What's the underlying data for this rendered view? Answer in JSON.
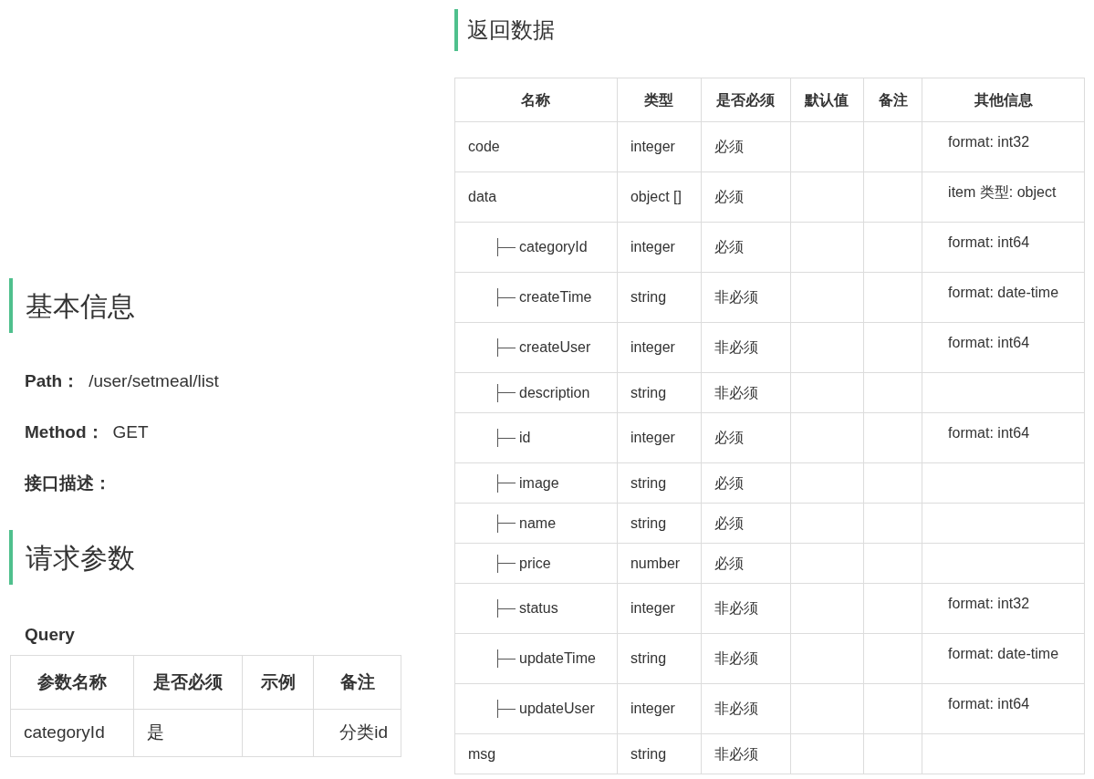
{
  "basic_info": {
    "heading": "基本信息",
    "fields": [
      {
        "label": "Path：",
        "value": "/user/setmeal/list"
      },
      {
        "label": "Method：",
        "value": "GET"
      },
      {
        "label": "接口描述："
      }
    ]
  },
  "request_params": {
    "heading": "请求参数",
    "query_title": "Query",
    "table": {
      "columns": [
        "参数名称",
        "是否必须",
        "示例",
        "备注"
      ],
      "rows": [
        [
          "categoryId",
          "是",
          "",
          "分类id"
        ]
      ]
    }
  },
  "response": {
    "heading": "返回数据",
    "table": {
      "columns": [
        "名称",
        "类型",
        "是否必须",
        "默认值",
        "备注",
        "其他信息"
      ],
      "rows": [
        {
          "name": "code",
          "type": "integer",
          "required": "必须",
          "info": "format: int32"
        },
        {
          "name": "data",
          "type": "object []",
          "required": "必须",
          "info": "item 类型: object",
          "children": [
            {
              "name": "categoryId",
              "type": "integer",
              "required": "必须",
              "info": "format: int64"
            },
            {
              "name": "createTime",
              "type": "string",
              "required": "非必须",
              "info": "format: date-time"
            },
            {
              "name": "createUser",
              "type": "integer",
              "required": "非必须",
              "info": "format: int64"
            },
            {
              "name": "description",
              "type": "string",
              "required": "非必须"
            },
            {
              "name": "id",
              "type": "integer",
              "required": "必须",
              "info": "format: int64"
            },
            {
              "name": "image",
              "type": "string",
              "required": "必须"
            },
            {
              "name": "name",
              "type": "string",
              "required": "必须"
            },
            {
              "name": "price",
              "type": "number",
              "required": "必须"
            },
            {
              "name": "status",
              "type": "integer",
              "required": "非必须",
              "info": "format: int32"
            },
            {
              "name": "updateTime",
              "type": "string",
              "required": "非必须",
              "info": "format: date-time"
            },
            {
              "name": "updateUser",
              "type": "integer",
              "required": "非必须",
              "info": "format: int64"
            }
          ]
        },
        {
          "name": "msg",
          "type": "string",
          "required": "非必须"
        }
      ]
    }
  }
}
